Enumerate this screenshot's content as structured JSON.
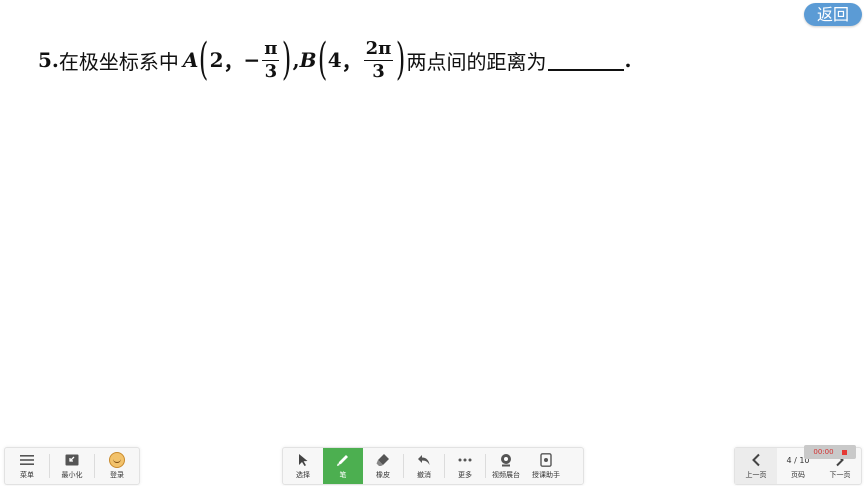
{
  "return_label": "返回",
  "problem": {
    "number": "5.",
    "lead": "在极坐标系中",
    "point_a": "A",
    "a_r": "2",
    "comma": "，",
    "neg": "−",
    "a_num": "π",
    "a_den": "3",
    "sep": ",",
    "point_b": "B",
    "b_r": "4",
    "b_num": "2π",
    "b_den": "3",
    "tail": "两点间的距离为",
    "end": "."
  },
  "left_toolbar": [
    {
      "label": "菜单",
      "icon": "menu-icon"
    },
    {
      "label": "最小化",
      "icon": "minimize-icon"
    },
    {
      "label": "登录",
      "icon": "avatar-icon"
    }
  ],
  "middle_toolbar": [
    {
      "label": "选择",
      "icon": "cursor-icon"
    },
    {
      "label": "笔",
      "icon": "pen-icon"
    },
    {
      "label": "橡皮",
      "icon": "eraser-icon"
    },
    {
      "label": "撤消",
      "icon": "undo-icon"
    },
    {
      "label": "更多",
      "icon": "more-icon"
    },
    {
      "label": "视频展台",
      "icon": "webcam-icon"
    },
    {
      "label": "授课助手",
      "icon": "assistant-icon"
    }
  ],
  "right_toolbar": {
    "prev_label": "上一页",
    "page_label": "页码",
    "next_label": "下一页",
    "page_current": "4",
    "page_total": "10",
    "page_text": "4 / 10"
  },
  "timer": "00:00",
  "colors": {
    "return_button": "#5b9bd5",
    "active_tool": "#4caf50",
    "timer_text": "#d32f2f"
  }
}
